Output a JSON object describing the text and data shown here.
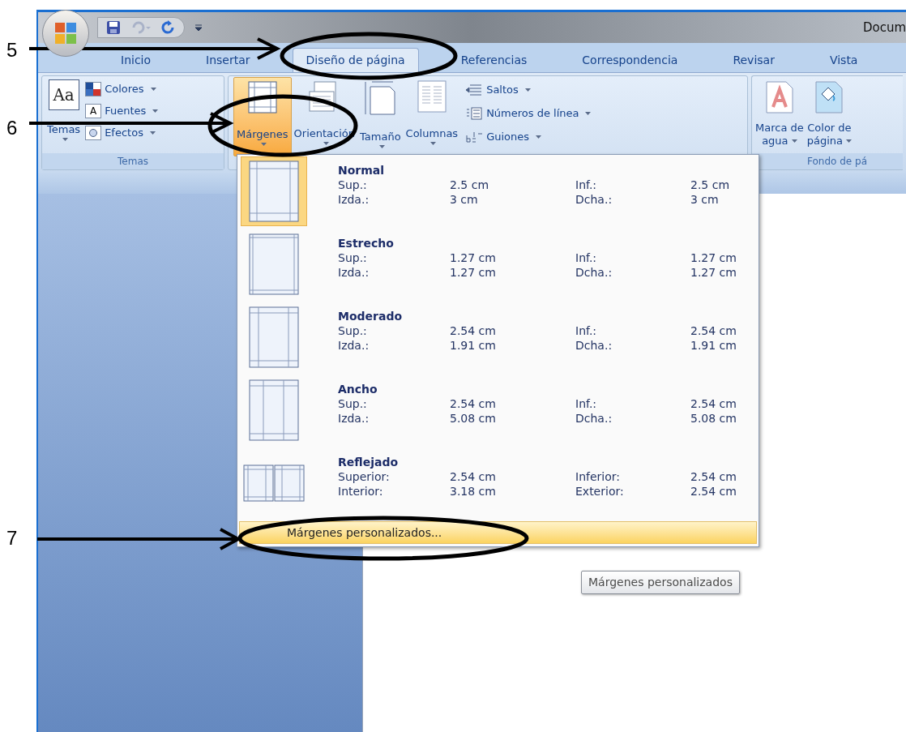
{
  "annotations": [
    {
      "label": "5"
    },
    {
      "label": "6"
    },
    {
      "label": "7"
    }
  ],
  "title_bar": {
    "title": "Docum"
  },
  "tabs": [
    {
      "label": "Inicio",
      "selected": false
    },
    {
      "label": "Insertar",
      "selected": false
    },
    {
      "label": "Diseño de página",
      "selected": true
    },
    {
      "label": "Referencias",
      "selected": false
    },
    {
      "label": "Correspondencia",
      "selected": false
    },
    {
      "label": "Revisar",
      "selected": false
    },
    {
      "label": "Vista",
      "selected": false
    }
  ],
  "themes_group": {
    "label": "Temas",
    "big_button": "Temas",
    "icon_glyph": "Aa",
    "font_glyph": "A",
    "items": [
      "Colores",
      "Fuentes",
      "Efectos"
    ]
  },
  "page_setup_group": {
    "buttons": [
      {
        "label": "Márgenes",
        "selected": true
      },
      {
        "label": "Orientación",
        "selected": false
      },
      {
        "label": "Tamaño",
        "selected": false
      },
      {
        "label": "Columnas",
        "selected": false
      }
    ],
    "items": [
      "Saltos",
      "Números de línea",
      "Guiones"
    ]
  },
  "background_group": {
    "label": "Fondo de pá",
    "buttons": [
      {
        "lines": [
          "Marca de",
          "agua"
        ]
      },
      {
        "lines": [
          "Color de",
          "página"
        ]
      }
    ]
  },
  "margins_menu": {
    "items": [
      {
        "name": "Normal",
        "kind": "normal",
        "selected": true,
        "rows": [
          [
            "Sup.:",
            "2.5 cm",
            "Inf.:",
            "2.5 cm"
          ],
          [
            "Izda.:",
            "3 cm",
            "Dcha.:",
            "3 cm"
          ]
        ]
      },
      {
        "name": "Estrecho",
        "kind": "narrow",
        "selected": false,
        "rows": [
          [
            "Sup.:",
            "1.27 cm",
            "Inf.:",
            "1.27 cm"
          ],
          [
            "Izda.:",
            "1.27 cm",
            "Dcha.:",
            "1.27 cm"
          ]
        ]
      },
      {
        "name": "Moderado",
        "kind": "moderate",
        "selected": false,
        "rows": [
          [
            "Sup.:",
            "2.54 cm",
            "Inf.:",
            "2.54 cm"
          ],
          [
            "Izda.:",
            "1.91 cm",
            "Dcha.:",
            "1.91 cm"
          ]
        ]
      },
      {
        "name": "Ancho",
        "kind": "wide",
        "selected": false,
        "rows": [
          [
            "Sup.:",
            "2.54 cm",
            "Inf.:",
            "2.54 cm"
          ],
          [
            "Izda.:",
            "5.08 cm",
            "Dcha.:",
            "5.08 cm"
          ]
        ]
      },
      {
        "name": "Reflejado",
        "kind": "mirrored",
        "selected": false,
        "rows": [
          [
            "Superior:",
            "2.54 cm",
            "Inferior:",
            "2.54 cm"
          ],
          [
            "Interior:",
            "3.18 cm",
            "Exterior:",
            "2.54 cm"
          ]
        ]
      }
    ],
    "custom": {
      "label": "Márgenes personalizados...",
      "highlighted": true
    }
  },
  "tooltip": {
    "text": "Márgenes personalizados"
  }
}
